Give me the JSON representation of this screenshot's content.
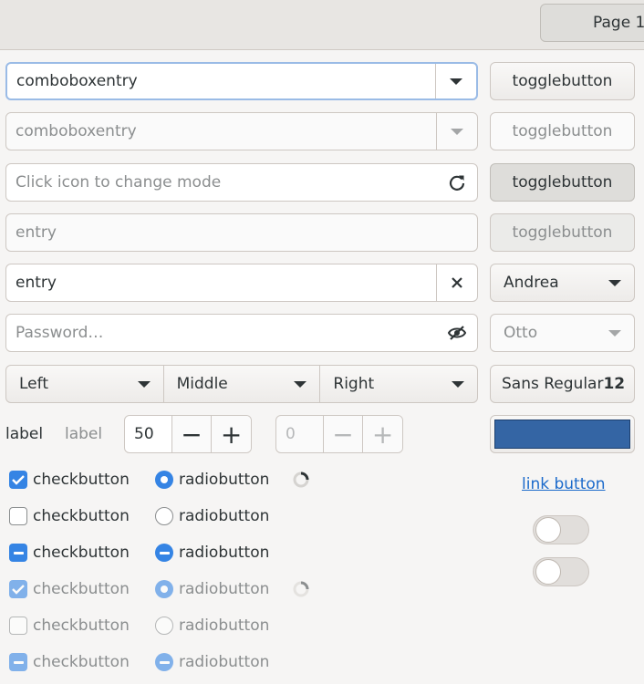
{
  "tabs": [
    {
      "label": "Page 1"
    }
  ],
  "combo_entry_1": {
    "value": "comboboxentry"
  },
  "combo_entry_2": {
    "value": "comboboxentry"
  },
  "mode_entry": {
    "placeholder": "Click icon to change mode"
  },
  "entry_disabled": {
    "placeholder": "entry"
  },
  "entry_clear": {
    "value": "entry"
  },
  "password": {
    "placeholder": "Password…"
  },
  "toggle_buttons": [
    "togglebutton",
    "togglebutton",
    "togglebutton",
    "togglebutton"
  ],
  "combo_andrea": "Andrea",
  "combo_otto": "Otto",
  "segmented": [
    "Left",
    "Middle",
    "Right"
  ],
  "font_button": {
    "name": "Sans Regular",
    "size": "12"
  },
  "labels": [
    "label",
    "label"
  ],
  "spin1": {
    "value": "50"
  },
  "spin2": {
    "value": "0"
  },
  "color_button": {
    "color": "#3465a4"
  },
  "link_button": "link button",
  "check_label": "checkbutton",
  "radio_label": "radiobutton",
  "accent": "#3584e4"
}
